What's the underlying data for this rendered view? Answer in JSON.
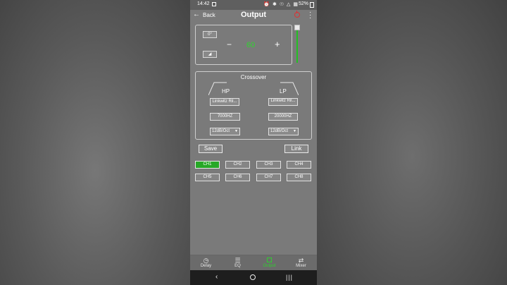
{
  "status_bar": {
    "time": "14:42",
    "icons": "⏰ ✱ ☉ △ ▦",
    "battery": "52%"
  },
  "header": {
    "back_label": "Back",
    "title": "Output"
  },
  "volume": {
    "phase": "0°",
    "mute_icon": "speaker-icon",
    "minus": "−",
    "value": "60",
    "plus": "+",
    "slider_level_percent": 100
  },
  "crossover": {
    "title": "Crossover",
    "hp": {
      "label": "HP",
      "type": "Linkwitz Ril...",
      "freq": "7000HZ",
      "slope": "12dB/Oct"
    },
    "lp": {
      "label": "LP",
      "type": "Linkwitz Ril...",
      "freq": "20000HZ",
      "slope": "12dB/Oct"
    }
  },
  "buttons": {
    "save": "Save",
    "link": "Link"
  },
  "channels": [
    "CH1",
    "CH2",
    "CH3",
    "CH4",
    "CH5",
    "CH6",
    "CH7",
    "CH8"
  ],
  "active_channel": "CH1",
  "bottom_nav": [
    {
      "label": "Delay",
      "icon": "clock-icon"
    },
    {
      "label": "EQ",
      "icon": "sliders-icon"
    },
    {
      "label": "Output",
      "icon": "output-icon"
    },
    {
      "label": "Mixer",
      "icon": "mixer-icon"
    }
  ],
  "active_tab": "Output",
  "colors": {
    "accent": "#27a827",
    "power": "#d33333",
    "panel_bg": "#7a7a7a"
  }
}
